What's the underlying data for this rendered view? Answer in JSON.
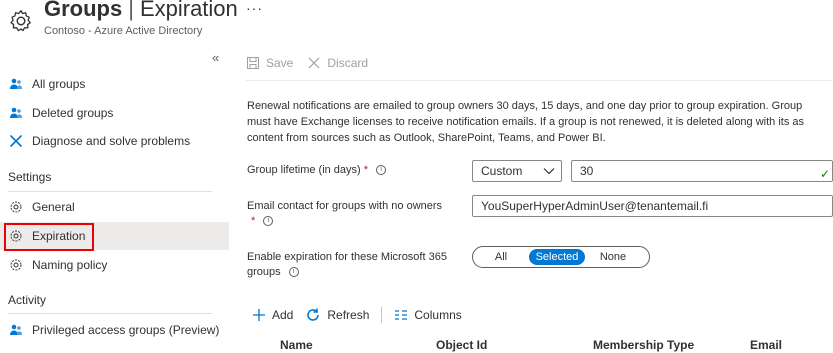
{
  "header": {
    "title_bold": "Groups",
    "title_sep": "|",
    "title_light": "Expiration",
    "subtitle": "Contoso - Azure Active Directory",
    "more": "···",
    "icon": "gear-icon"
  },
  "sidebar": {
    "collapse": "«",
    "items": [
      {
        "label": "All groups",
        "icon": "people-icon"
      },
      {
        "label": "Deleted groups",
        "icon": "people-icon"
      },
      {
        "label": "Diagnose and solve problems",
        "icon": "wrench-icon"
      }
    ],
    "settings_label": "Settings",
    "settings_items": [
      {
        "label": "General",
        "icon": "gear-icon"
      },
      {
        "label": "Expiration",
        "icon": "gear-icon",
        "active": true
      },
      {
        "label": "Naming policy",
        "icon": "gear-icon"
      }
    ],
    "activity_label": "Activity",
    "activity_items": [
      {
        "label": "Privileged access groups (Preview)",
        "icon": "people-icon"
      }
    ]
  },
  "toolbar": {
    "save": "Save",
    "discard": "Discard"
  },
  "description": {
    "line1": "Renewal notifications are emailed to group owners 30 days, 15 days, and one day prior to group expiration. Group",
    "line2": "must have Exchange licenses to receive notification emails. If a group is not renewed, it is deleted along with its as",
    "line3": "content from sources such as Outlook, SharePoint, Teams, and Power BI."
  },
  "form": {
    "lifetime_label": "Group lifetime (in days)",
    "lifetime_required": "*",
    "lifetime_info": "i",
    "lifetime_select": "Custom",
    "lifetime_value": "30",
    "email_label": "Email contact for groups with no owners",
    "email_required": "*",
    "email_info": "i",
    "email_value": "YouSuperHyperAdminUser@tenantemail.fi",
    "expiration_label_line1": "Enable expiration for these Microsoft 365",
    "expiration_label_line2": "groups",
    "expiration_info": "i",
    "expiration_options": [
      "All",
      "Selected",
      "None"
    ],
    "expiration_selected": "Selected"
  },
  "commands": {
    "add": "Add",
    "refresh": "Refresh",
    "columns": "Columns"
  },
  "table": {
    "columns": [
      "Name",
      "Object Id",
      "Membership Type",
      "Email"
    ]
  },
  "colors": {
    "accent": "#0078d4",
    "highlight": "#e00000",
    "valid": "#107c10"
  }
}
